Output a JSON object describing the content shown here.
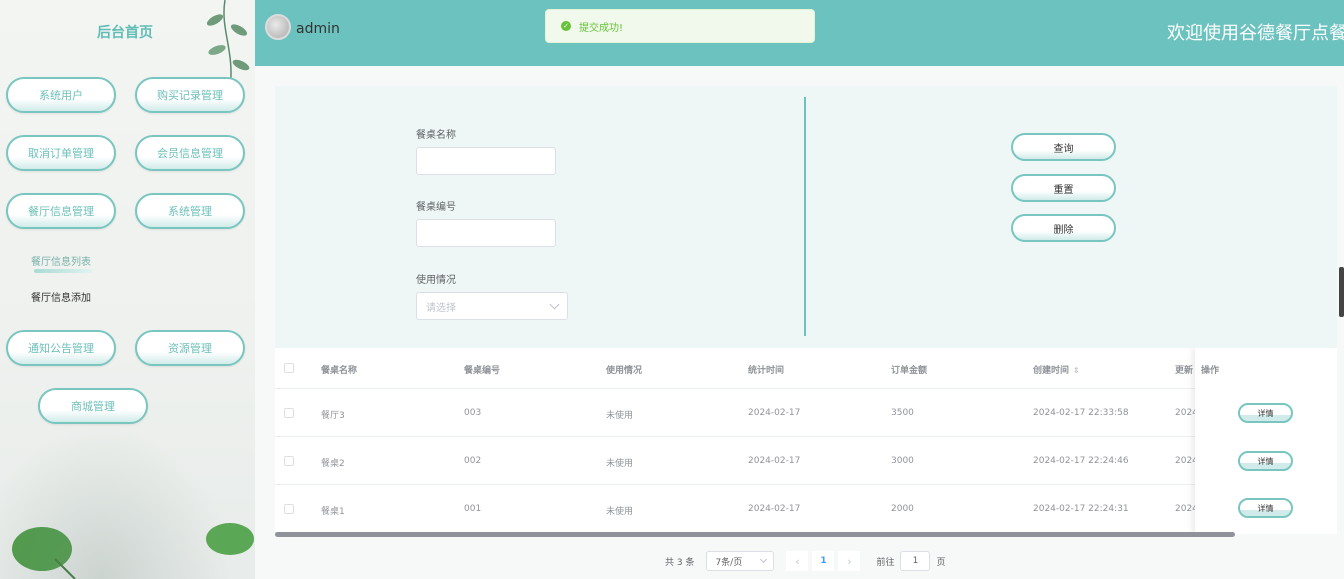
{
  "sidebar": {
    "brand": "后台首页",
    "menu": [
      {
        "label": "系统用户"
      },
      {
        "label": "购买记录管理"
      },
      {
        "label": "取消订单管理"
      },
      {
        "label": "会员信息管理"
      },
      {
        "label": "餐厅信息管理"
      },
      {
        "label": "系统管理"
      },
      {
        "label": "通知公告管理"
      },
      {
        "label": "资源管理"
      },
      {
        "label": "商城管理"
      }
    ],
    "submenu": [
      {
        "label": "餐厅信息列表",
        "active": true
      },
      {
        "label": "餐厅信息添加",
        "active": false
      }
    ]
  },
  "header": {
    "user": "admin",
    "welcome": "欢迎使用谷德餐厅点餐系"
  },
  "toast": {
    "message": "提交成功!",
    "icon": "check-circle-icon",
    "color": "#67c23a"
  },
  "search": {
    "fields": [
      {
        "label": "餐桌名称",
        "value": ""
      },
      {
        "label": "餐桌编号",
        "value": ""
      }
    ],
    "select": {
      "label": "使用情况",
      "placeholder": "请选择"
    },
    "buttons": {
      "query": "查询",
      "reset": "重置",
      "delete": "删除"
    }
  },
  "table": {
    "columns": [
      "餐桌名称",
      "餐桌编号",
      "使用情况",
      "统计时间",
      "订单金额",
      "创建时间",
      "更新",
      "操作"
    ],
    "rows": [
      {
        "name": "餐厅3",
        "code": "003",
        "status": "未使用",
        "stat_time": "2024-02-17",
        "amount": "3500",
        "created": "2024-02-17 22:33:58",
        "updated": "2024"
      },
      {
        "name": "餐桌2",
        "code": "002",
        "status": "未使用",
        "stat_time": "2024-02-17",
        "amount": "3000",
        "created": "2024-02-17 22:24:46",
        "updated": "2024"
      },
      {
        "name": "餐桌1",
        "code": "001",
        "status": "未使用",
        "stat_time": "2024-02-17",
        "amount": "2000",
        "created": "2024-02-17 22:24:31",
        "updated": "2024"
      }
    ],
    "detail_label": "详情"
  },
  "pagination": {
    "total": "共 3 条",
    "page_size": "7条/页",
    "prev": "‹",
    "current": "1",
    "next": "›",
    "goto_label": "前往",
    "goto_value": "1",
    "page_unit": "页"
  },
  "colors": {
    "accent": "#6cc2be",
    "panel": "#eef7f5",
    "success": "#67c23a"
  }
}
